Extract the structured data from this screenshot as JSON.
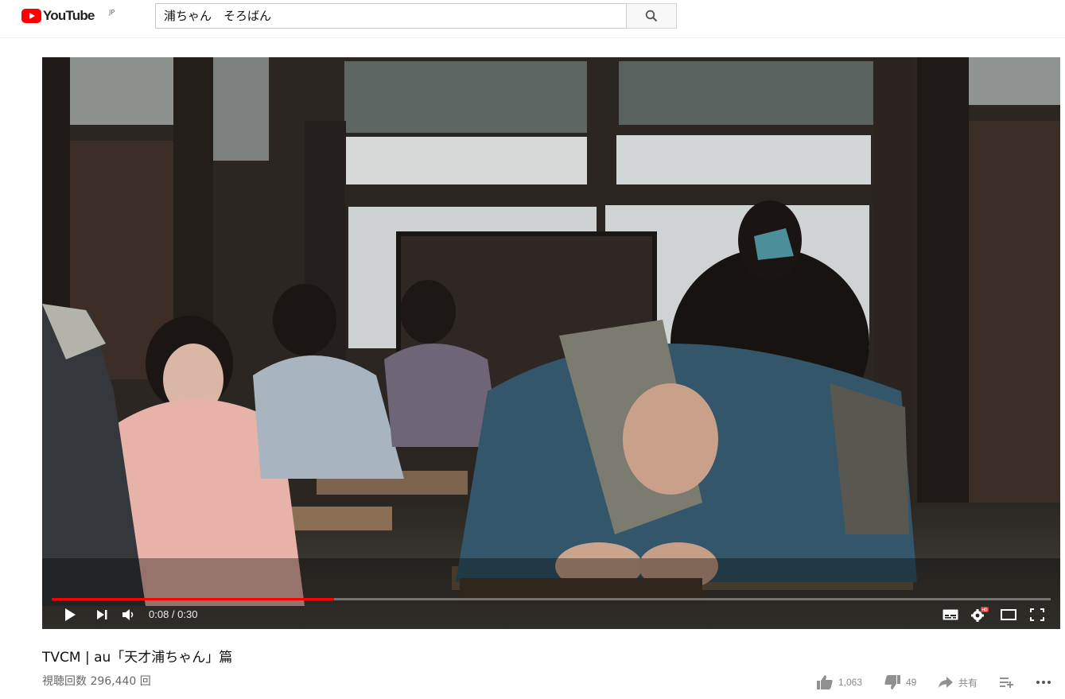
{
  "masthead": {
    "logo_text": "YouTube",
    "logo_region": "JP",
    "search_value": "浦ちゃん　そろばん"
  },
  "player": {
    "current_time": "0:08",
    "duration": "0:30",
    "time_display": "0:08 / 0:30",
    "progress_fraction": 0.283
  },
  "video": {
    "title": "TVCM | au「天才浦ちゃん」篇",
    "views": "視聴回数 296,440 回"
  },
  "actions": {
    "likes": "1,063",
    "dislikes": "49",
    "share": "共有"
  },
  "colors": {
    "brand_red": "#ff0000",
    "text_primary": "#111111",
    "text_secondary": "#666666",
    "icon_grey": "#909090"
  }
}
